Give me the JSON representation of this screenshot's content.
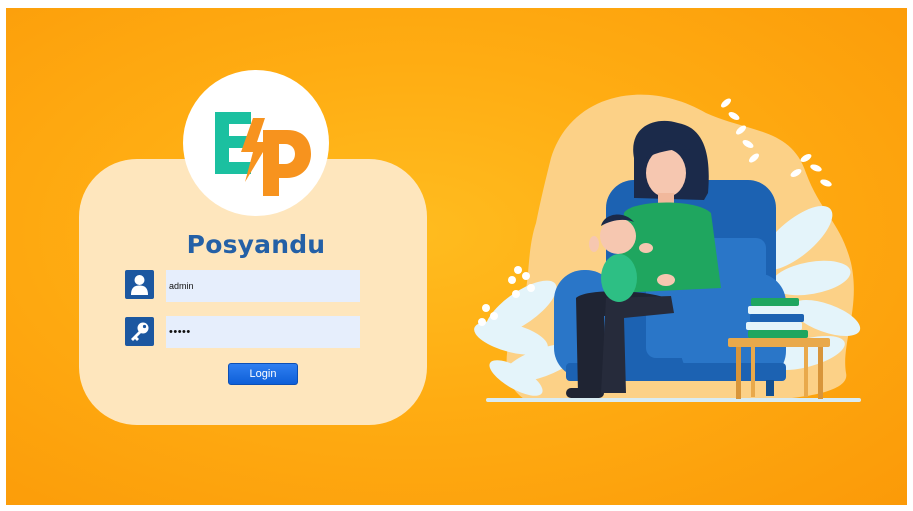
{
  "app": {
    "brand_name": "Posyandu",
    "logo_text": "EP"
  },
  "login": {
    "username_value": "admin",
    "password_value": "•••••",
    "button_label": "Login"
  },
  "icons": {
    "username": "user-icon",
    "password": "key-icon"
  },
  "colors": {
    "background": "#ffac12",
    "card": "#fee6bd",
    "brand_blue": "#2460a6",
    "logo_green": "#1bc0a0",
    "logo_orange": "#f7931e",
    "button": "#1467e0",
    "input_bg": "#e6eefc"
  }
}
